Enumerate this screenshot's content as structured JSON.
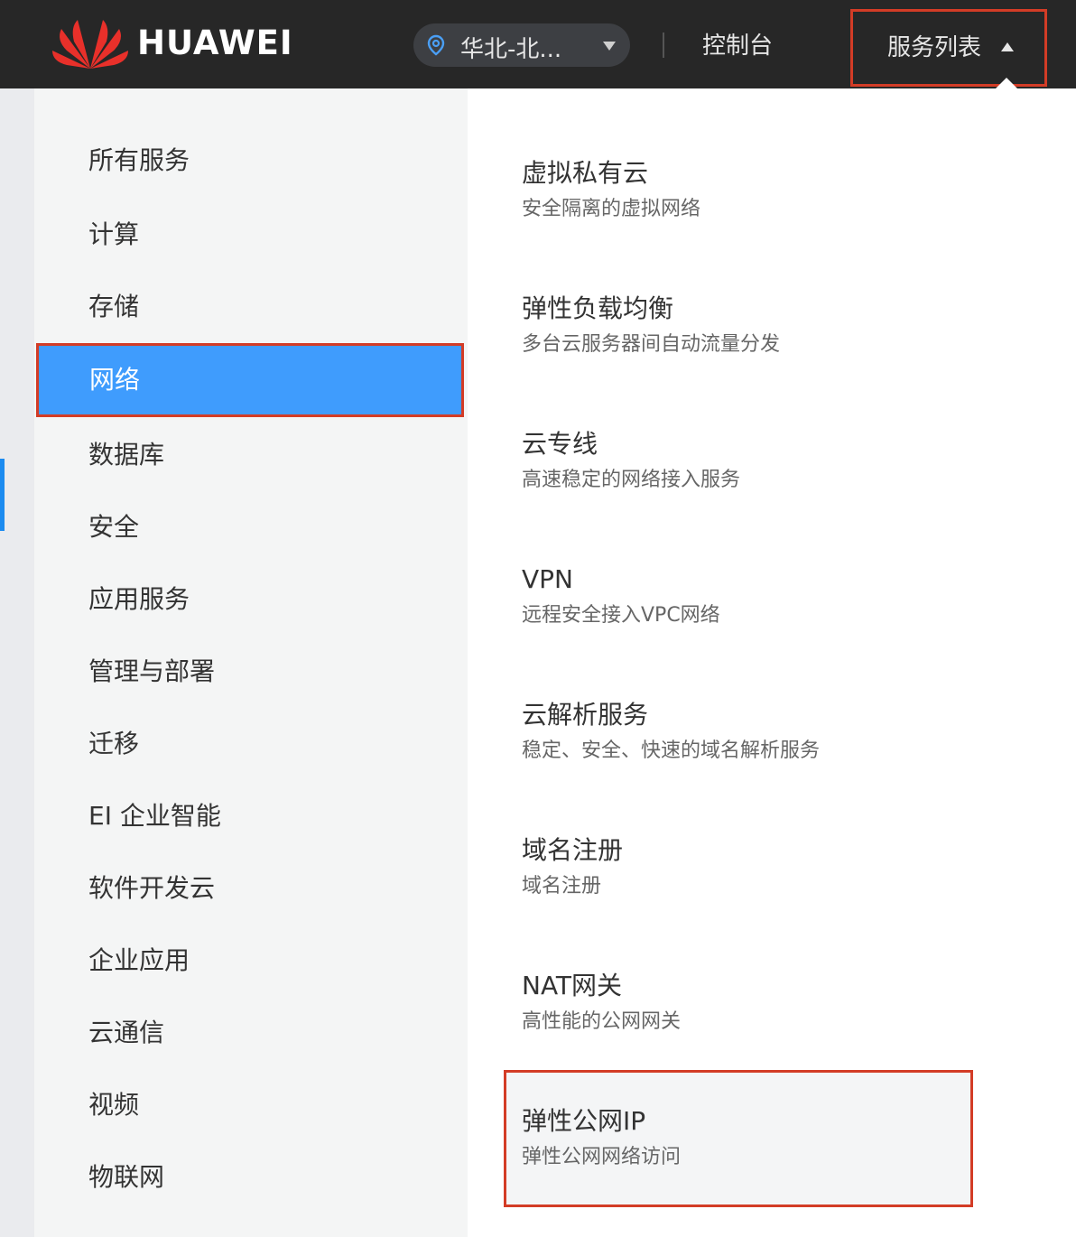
{
  "header": {
    "brand": "HUAWEI",
    "region": "华北-北...",
    "console": "控制台",
    "service_list": "服务列表",
    "colors": {
      "bar": "#272727",
      "highlight": "#d33c26"
    }
  },
  "categories": {
    "items": [
      "所有服务",
      "计算",
      "存储",
      "网络",
      "数据库",
      "安全",
      "应用服务",
      "管理与部署",
      "迁移",
      "EI 企业智能",
      "软件开发云",
      "企业应用",
      "云通信",
      "视频",
      "物联网"
    ],
    "active": "网络",
    "active_color": "#3f9cfd"
  },
  "services": [
    {
      "title": "虚拟私有云",
      "desc": "安全隔离的虚拟网络"
    },
    {
      "title": "弹性负载均衡",
      "desc": "多台云服务器间自动流量分发"
    },
    {
      "title": "云专线",
      "desc": "高速稳定的网络接入服务"
    },
    {
      "title": "VPN",
      "desc": "远程安全接入VPC网络"
    },
    {
      "title": "云解析服务",
      "desc": "稳定、安全、快速的域名解析服务"
    },
    {
      "title": "域名注册",
      "desc": "域名注册"
    },
    {
      "title": "NAT网关",
      "desc": "高性能的公网网关"
    },
    {
      "title": "弹性公网IP",
      "desc": "弹性公网网络访问"
    }
  ],
  "icons": [
    "huawei-logo-icon",
    "location-pin-icon",
    "caret-down-icon",
    "caret-up-icon"
  ]
}
